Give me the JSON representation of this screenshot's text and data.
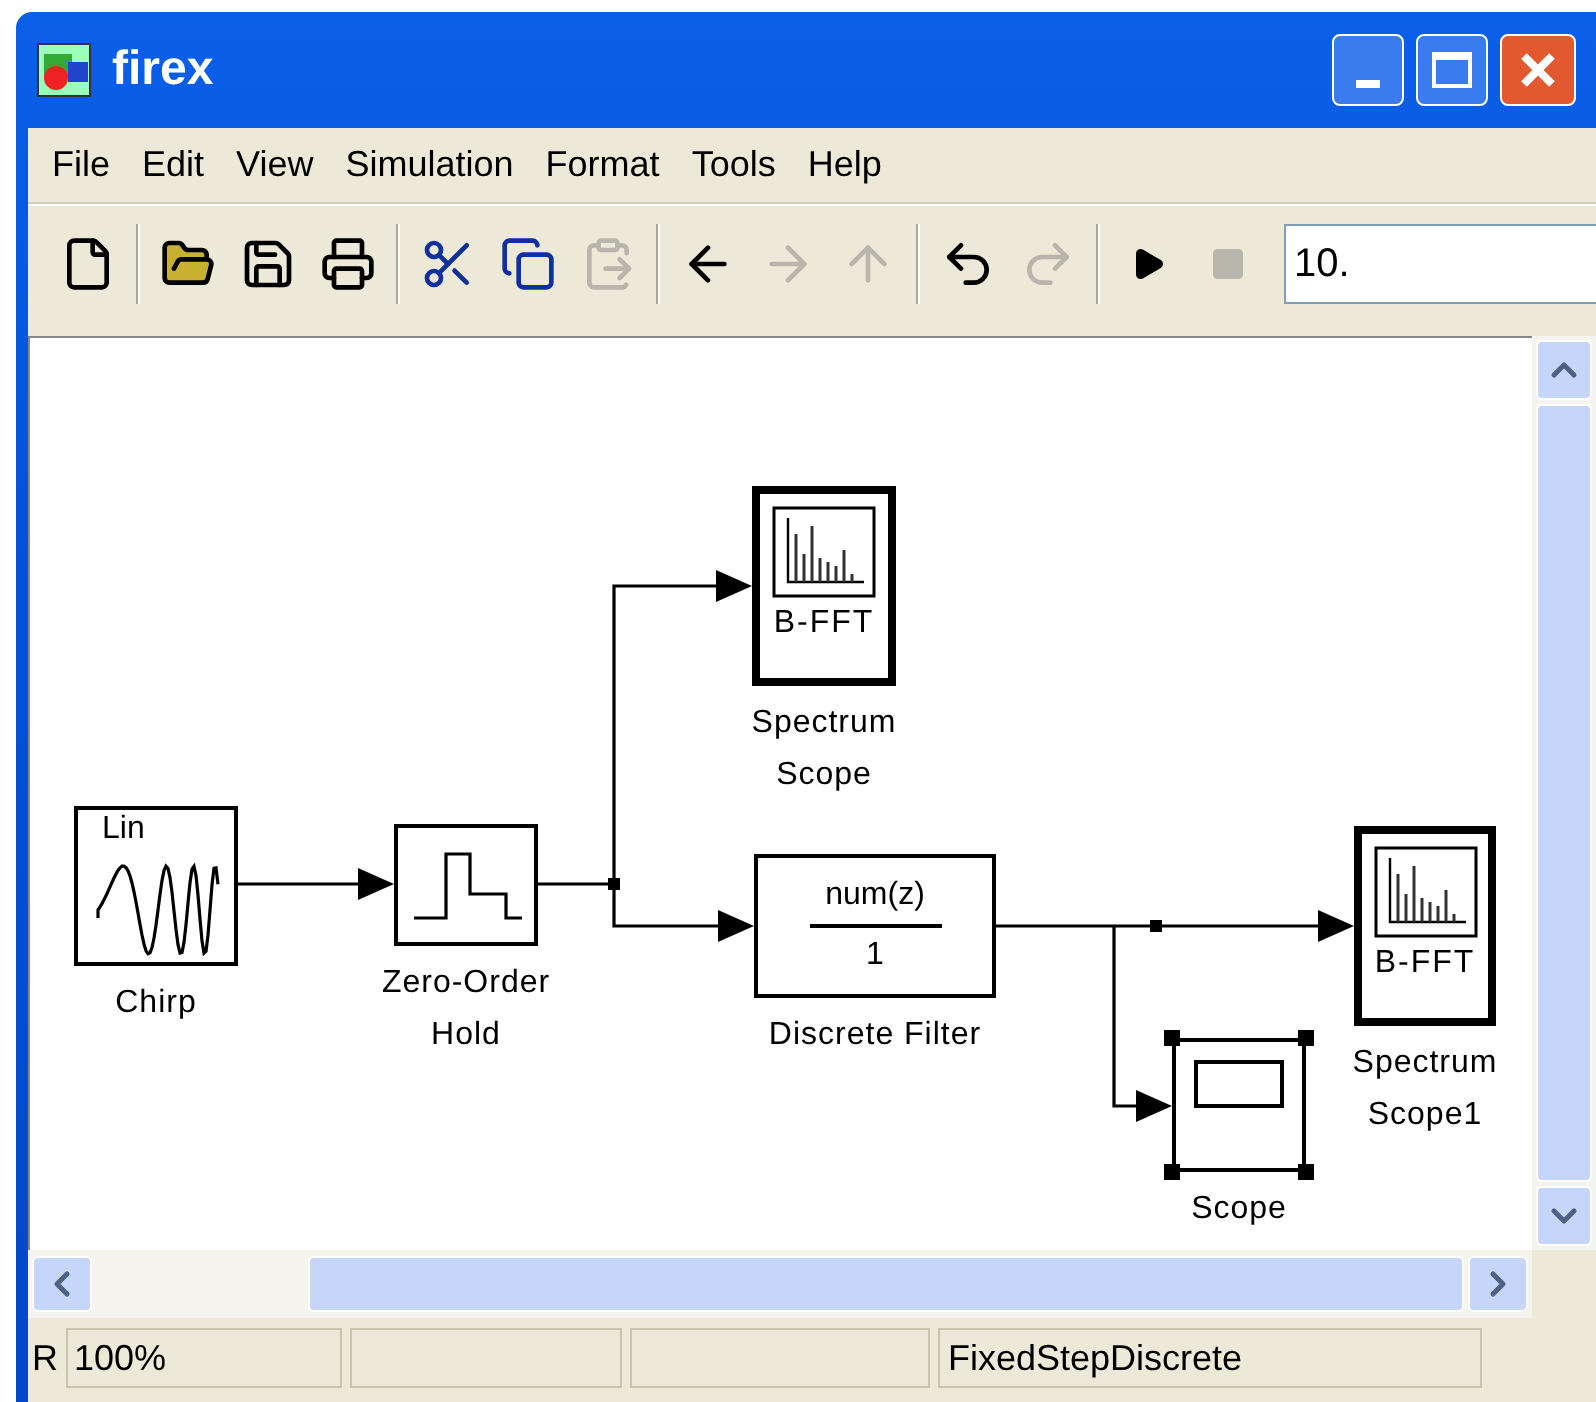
{
  "window": {
    "title": "firex"
  },
  "menu": [
    "File",
    "Edit",
    "View",
    "Simulation",
    "Format",
    "Tools",
    "Help"
  ],
  "toolbar": {
    "buttons": [
      {
        "disabled": false
      },
      {
        "disabled": false
      },
      {
        "disabled": false
      },
      {
        "disabled": false
      },
      {
        "disabled": false
      },
      {
        "disabled": false
      },
      {
        "disabled": true
      },
      {
        "disabled": false
      },
      {
        "disabled": true
      },
      {
        "disabled": true
      },
      {
        "disabled": false
      },
      {
        "disabled": true
      },
      {
        "disabled": false
      },
      {
        "disabled": true
      }
    ],
    "stop_time": "10."
  },
  "blocks": [
    {
      "kind": "chirp",
      "text": "Lin",
      "label_lines": [
        "Chirp"
      ],
      "selected": false
    },
    {
      "kind": "zoh",
      "label_lines": [
        "Zero-Order",
        "Hold"
      ],
      "selected": false
    },
    {
      "kind": "spectrum",
      "text": "B-FFT",
      "label_lines": [
        "Spectrum",
        "Scope"
      ],
      "selected": false
    },
    {
      "kind": "filter",
      "numerator": "num(z)",
      "denominator": "1",
      "label_lines": [
        "Discrete Filter"
      ],
      "selected": false
    },
    {
      "kind": "spectrum",
      "text": "B-FFT",
      "label_lines": [
        "Spectrum",
        "Scope1"
      ],
      "selected": false
    },
    {
      "kind": "scope",
      "label_lines": [
        "Scope"
      ],
      "selected": true
    }
  ],
  "status_bar": {
    "mode": "R",
    "zoom": "100%",
    "solver": "FixedStepDiscrete"
  }
}
